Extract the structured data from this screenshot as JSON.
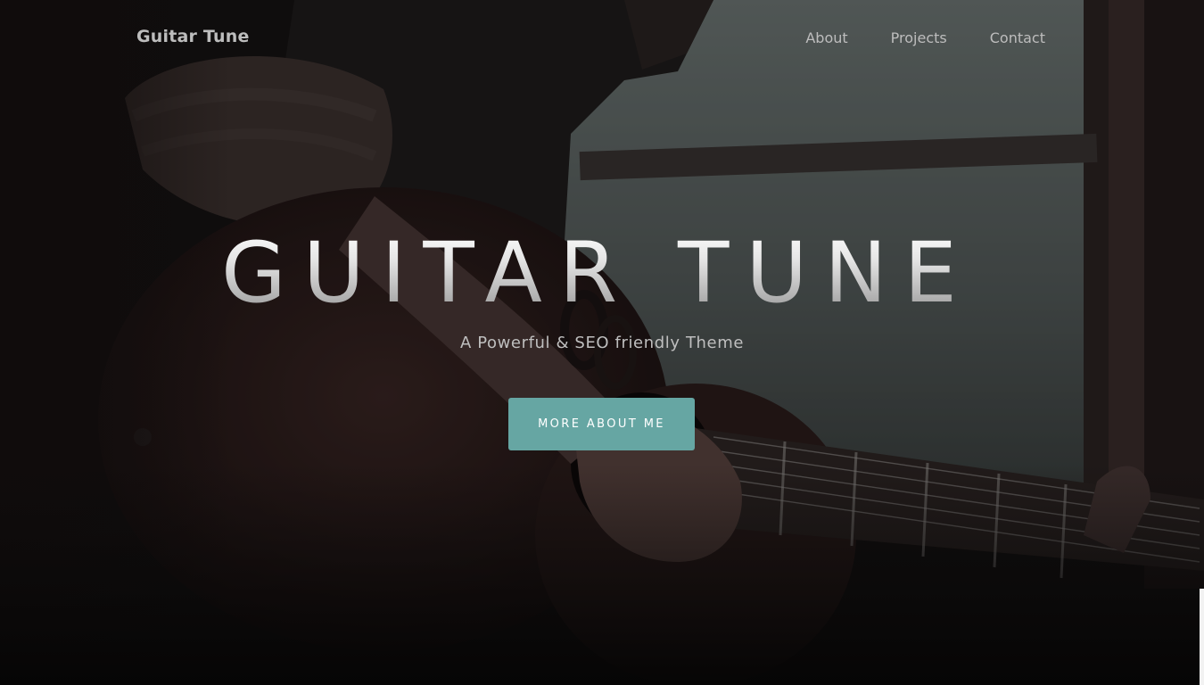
{
  "navbar": {
    "brand": "Guitar Tune",
    "links": [
      "About",
      "Projects",
      "Contact"
    ]
  },
  "hero": {
    "title": "GUITAR TUNE",
    "subtitle": "A Powerful & SEO friendly Theme",
    "cta_label": "MORE ABOUT ME",
    "background_image": "guitarist-playing-acoustic-guitar-photo"
  },
  "colors": {
    "accent": "#66a6a3",
    "nav_text": "#bdbdbd",
    "background": "#0b0a0a"
  }
}
